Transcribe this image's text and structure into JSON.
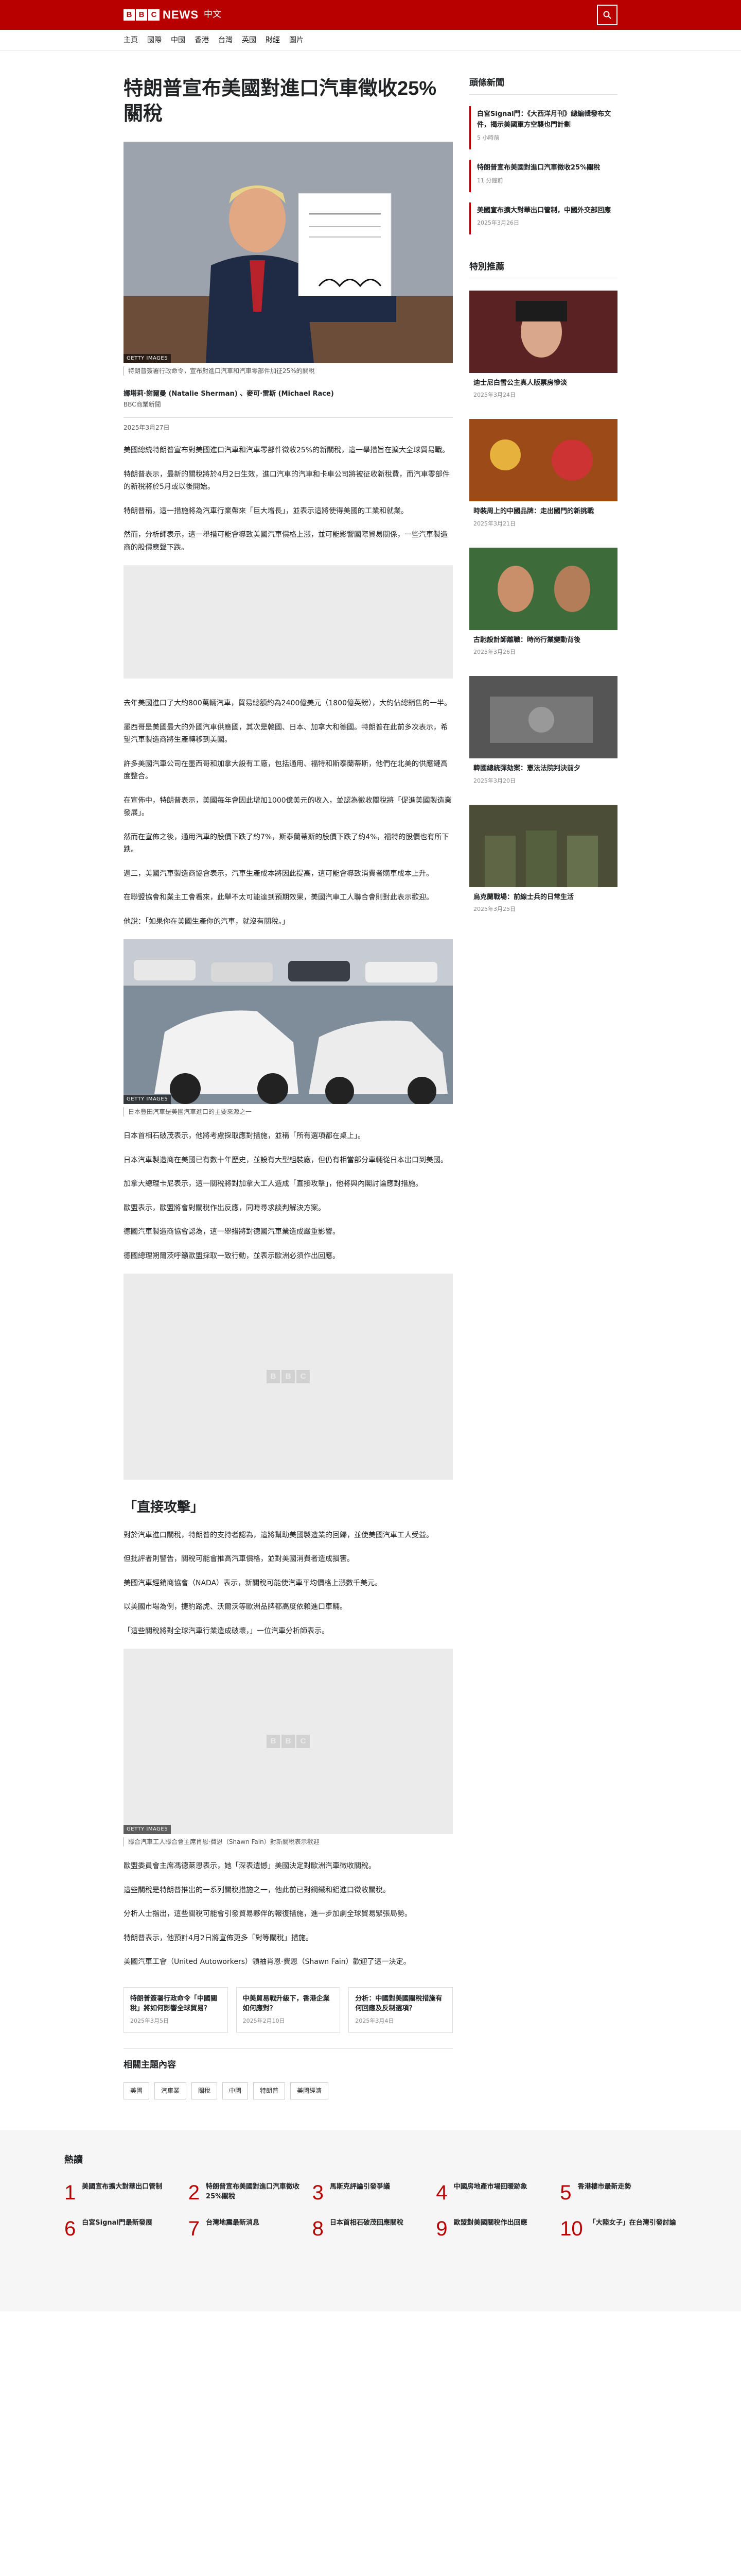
{
  "brand": {
    "news": "NEWS",
    "lang": "中文",
    "blocks": [
      "B",
      "B",
      "C"
    ]
  },
  "nav": [
    "主頁",
    "國際",
    "中國",
    "香港",
    "台灣",
    "英國",
    "財經",
    "圖片"
  ],
  "article": {
    "title": "特朗普宣布美國對進口汽車徵收25%關稅",
    "hero_credit": "GETTY IMAGES",
    "hero_caption": "特朗普簽署行政命令，宣布對進口汽車和汽車零部件加征25%的關稅",
    "byline_names": "娜塔莉·謝爾曼 (Natalie Sherman) 、麥可·雷斯 (Michael Race)",
    "byline_org": "BBC商業新聞",
    "byline_date": "2025年3月27日",
    "paras_a": [
      "美國總統特朗普宣布對美國進口汽車和汽車零部件徵收25%的新關稅，這一舉措旨在擴大全球貿易戰。",
      "特朗普表示，最新的關稅將於4月2日生效，進口汽車的汽車和卡車公司將被征收新稅費，而汽車零部件的新稅將於5月或以後開始。",
      "特朗普稱，這一措施將為汽車行業帶來「巨大增長」，並表示這將使得美國的工業和就業。",
      "然而，分析師表示，這一舉措可能會導致美國汽車價格上漲，並可能影響國際貿易關係，一些汽車製造商的股價應聲下跌。"
    ],
    "paras_b": [
      "去年美國進口了大約800萬輛汽車，貿易總額約為2400億美元（1800億英鎊），大約佔總銷售的一半。",
      "墨西哥是美國最大的外國汽車供應國，其次是韓國、日本、加拿大和德國。特朗普在此前多次表示，希望汽車製造商將生產轉移到美國。",
      "許多美國汽車公司在墨西哥和加拿大設有工廠，包括通用、福特和斯泰蘭蒂斯，他們在北美的供應鏈高度整合。",
      "在宣佈中，特朗普表示，美國每年會因此增加1000億美元的收入，並認為徵收關稅將「促進美國製造業發展」。",
      "然而在宣佈之後，通用汽車的股價下跌了約7%，斯泰蘭蒂斯的股價下跌了約4%，福特的股價也有所下跌。",
      "週三，美國汽車製造商協會表示，汽車生產成本將因此提高，這可能會導致消費者購車成本上升。",
      "在聯盟協會和業主工會看來，此舉不太可能達到預期效果，美國汽車工人聯合會則對此表示歡迎。",
      "他說：「如果你在美國生產你的汽車，就沒有關稅。」"
    ],
    "img2_credit": "GETTY IMAGES",
    "img2_caption": "日本豐田汽車是美國汽車進口的主要來源之一",
    "paras_c": [
      "日本首相石破茂表示，他將考慮採取應對措施，並稱「所有選項都在桌上」。",
      "日本汽車製造商在美國已有數十年歷史，並設有大型組裝廠，但仍有相當部分車輛從日本出口到美國。",
      "加拿大總理卡尼表示，這一關稅將對加拿大工人造成「直接攻擊」，他將與內閣討論應對措施。",
      "歐盟表示，歐盟將會對關稅作出反應，同時尋求談判解決方案。",
      "德國汽車製造商協會認為，這一舉措將對德國汽車業造成嚴重影響。",
      "德國總理朔爾茨呼籲歐盟採取一致行動，並表示歐洲必須作出回應。"
    ],
    "sub_heading": "「直接攻擊」",
    "paras_d": [
      "對於汽車進口關稅，特朗普的支持者認為，這將幫助美國製造業的回歸，並使美國汽車工人受益。",
      "但批評者則警告，關稅可能會推高汽車價格，並對美國消費者造成損害。",
      "美國汽車經銷商協會（NADA）表示，新關稅可能使汽車平均價格上漲數千美元。",
      "以美國市場為例，捷豹路虎、沃爾沃等歐洲品牌都高度依賴進口車輛。",
      "「這些關稅將對全球汽車行業造成破壞，」一位汽車分析師表示。"
    ],
    "img3_credit": "GETTY IMAGES",
    "img3_caption": "聯合汽車工人聯合會主席肖恩·費恩（Shawn Fain）對新關稅表示歡迎",
    "paras_e": [
      "歐盟委員會主席馮德萊恩表示，她「深表遺憾」美國決定對歐洲汽車徵收關稅。",
      "這些關稅是特朗普推出的一系列關稅措施之一，他此前已對鋼鐵和鋁進口徵收關稅。",
      "分析人士指出，這些關稅可能會引發貿易夥伴的報復措施，進一步加劇全球貿易緊張局勢。",
      "特朗普表示，他預計4月2日將宣佈更多「對等關稅」措施。",
      "美國汽車工會（United Autoworkers）領袖肖恩·費恩（Shawn Fain）歡迎了這一決定。"
    ],
    "related": [
      {
        "title": "特朗普簽署行政命令「中國關稅」將如何影響全球貿易？",
        "date": "2025年3月5日"
      },
      {
        "title": "中美貿易戰升級下，香港企業如何應對？",
        "date": "2025年2月10日"
      },
      {
        "title": "分析：中國對美國關稅措施有何回應及反制選項？",
        "date": "2025年3月4日"
      }
    ],
    "topics_title": "相關主題內容",
    "topics": [
      "美國",
      "汽車業",
      "關稅",
      "中國",
      "特朗普",
      "美國經濟"
    ]
  },
  "sidebar": {
    "top_title": "頭條新聞",
    "top": [
      {
        "title": "白宮Signal門：《大西洋月刊》總編輯發布文件，揭示美國軍方空襲也門計劃",
        "date": "5 小時前"
      },
      {
        "title": "特朗普宣布美國對進口汽車徵收25%關稅",
        "date": "11 分鐘前"
      },
      {
        "title": "美國宣布擴大對華出口管制，中國外交部回應",
        "date": "2025年3月26日"
      }
    ],
    "feat_title": "特別推薦",
    "feat": [
      {
        "title": "迪士尼白雪公主真人版票房慘淡",
        "date": "2025年3月24日"
      },
      {
        "title": "時裝周上的中國品牌：走出國門的新挑戰",
        "date": "2025年3月21日"
      },
      {
        "title": "古馳設計師離職：時尚行業變動背後",
        "date": "2025年3月26日"
      },
      {
        "title": "韓國總統彈劾案：憲法法院判決前夕",
        "date": "2025年3月20日"
      },
      {
        "title": "烏克蘭戰場：前線士兵的日常生活",
        "date": "2025年3月25日"
      }
    ]
  },
  "popular": {
    "title": "熱讀",
    "items": [
      "美國宣布擴大對華出口管制",
      "特朗普宣布美國對進口汽車徵收25%關稅",
      "馬斯克評論引發爭議",
      "中國房地產市場回暖跡象",
      "香港樓市最新走勢",
      "白宮Signal門最新發展",
      "台灣地震最新消息",
      "日本首相石破茂回應關稅",
      "歐盟對美國關稅作出回應",
      "「大陸女子」在台灣引發討論"
    ]
  }
}
